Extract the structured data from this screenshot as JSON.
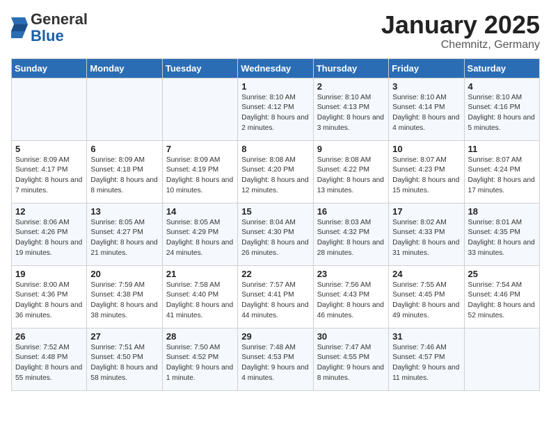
{
  "logo": {
    "general": "General",
    "blue": "Blue"
  },
  "title": "January 2025",
  "location": "Chemnitz, Germany",
  "days_of_week": [
    "Sunday",
    "Monday",
    "Tuesday",
    "Wednesday",
    "Thursday",
    "Friday",
    "Saturday"
  ],
  "weeks": [
    [
      {
        "day": "",
        "info": ""
      },
      {
        "day": "",
        "info": ""
      },
      {
        "day": "",
        "info": ""
      },
      {
        "day": "1",
        "info": "Sunrise: 8:10 AM\nSunset: 4:12 PM\nDaylight: 8 hours and 2 minutes."
      },
      {
        "day": "2",
        "info": "Sunrise: 8:10 AM\nSunset: 4:13 PM\nDaylight: 8 hours and 3 minutes."
      },
      {
        "day": "3",
        "info": "Sunrise: 8:10 AM\nSunset: 4:14 PM\nDaylight: 8 hours and 4 minutes."
      },
      {
        "day": "4",
        "info": "Sunrise: 8:10 AM\nSunset: 4:16 PM\nDaylight: 8 hours and 5 minutes."
      }
    ],
    [
      {
        "day": "5",
        "info": "Sunrise: 8:09 AM\nSunset: 4:17 PM\nDaylight: 8 hours and 7 minutes."
      },
      {
        "day": "6",
        "info": "Sunrise: 8:09 AM\nSunset: 4:18 PM\nDaylight: 8 hours and 8 minutes."
      },
      {
        "day": "7",
        "info": "Sunrise: 8:09 AM\nSunset: 4:19 PM\nDaylight: 8 hours and 10 minutes."
      },
      {
        "day": "8",
        "info": "Sunrise: 8:08 AM\nSunset: 4:20 PM\nDaylight: 8 hours and 12 minutes."
      },
      {
        "day": "9",
        "info": "Sunrise: 8:08 AM\nSunset: 4:22 PM\nDaylight: 8 hours and 13 minutes."
      },
      {
        "day": "10",
        "info": "Sunrise: 8:07 AM\nSunset: 4:23 PM\nDaylight: 8 hours and 15 minutes."
      },
      {
        "day": "11",
        "info": "Sunrise: 8:07 AM\nSunset: 4:24 PM\nDaylight: 8 hours and 17 minutes."
      }
    ],
    [
      {
        "day": "12",
        "info": "Sunrise: 8:06 AM\nSunset: 4:26 PM\nDaylight: 8 hours and 19 minutes."
      },
      {
        "day": "13",
        "info": "Sunrise: 8:05 AM\nSunset: 4:27 PM\nDaylight: 8 hours and 21 minutes."
      },
      {
        "day": "14",
        "info": "Sunrise: 8:05 AM\nSunset: 4:29 PM\nDaylight: 8 hours and 24 minutes."
      },
      {
        "day": "15",
        "info": "Sunrise: 8:04 AM\nSunset: 4:30 PM\nDaylight: 8 hours and 26 minutes."
      },
      {
        "day": "16",
        "info": "Sunrise: 8:03 AM\nSunset: 4:32 PM\nDaylight: 8 hours and 28 minutes."
      },
      {
        "day": "17",
        "info": "Sunrise: 8:02 AM\nSunset: 4:33 PM\nDaylight: 8 hours and 31 minutes."
      },
      {
        "day": "18",
        "info": "Sunrise: 8:01 AM\nSunset: 4:35 PM\nDaylight: 8 hours and 33 minutes."
      }
    ],
    [
      {
        "day": "19",
        "info": "Sunrise: 8:00 AM\nSunset: 4:36 PM\nDaylight: 8 hours and 36 minutes."
      },
      {
        "day": "20",
        "info": "Sunrise: 7:59 AM\nSunset: 4:38 PM\nDaylight: 8 hours and 38 minutes."
      },
      {
        "day": "21",
        "info": "Sunrise: 7:58 AM\nSunset: 4:40 PM\nDaylight: 8 hours and 41 minutes."
      },
      {
        "day": "22",
        "info": "Sunrise: 7:57 AM\nSunset: 4:41 PM\nDaylight: 8 hours and 44 minutes."
      },
      {
        "day": "23",
        "info": "Sunrise: 7:56 AM\nSunset: 4:43 PM\nDaylight: 8 hours and 46 minutes."
      },
      {
        "day": "24",
        "info": "Sunrise: 7:55 AM\nSunset: 4:45 PM\nDaylight: 8 hours and 49 minutes."
      },
      {
        "day": "25",
        "info": "Sunrise: 7:54 AM\nSunset: 4:46 PM\nDaylight: 8 hours and 52 minutes."
      }
    ],
    [
      {
        "day": "26",
        "info": "Sunrise: 7:52 AM\nSunset: 4:48 PM\nDaylight: 8 hours and 55 minutes."
      },
      {
        "day": "27",
        "info": "Sunrise: 7:51 AM\nSunset: 4:50 PM\nDaylight: 8 hours and 58 minutes."
      },
      {
        "day": "28",
        "info": "Sunrise: 7:50 AM\nSunset: 4:52 PM\nDaylight: 9 hours and 1 minute."
      },
      {
        "day": "29",
        "info": "Sunrise: 7:48 AM\nSunset: 4:53 PM\nDaylight: 9 hours and 4 minutes."
      },
      {
        "day": "30",
        "info": "Sunrise: 7:47 AM\nSunset: 4:55 PM\nDaylight: 9 hours and 8 minutes."
      },
      {
        "day": "31",
        "info": "Sunrise: 7:46 AM\nSunset: 4:57 PM\nDaylight: 9 hours and 11 minutes."
      },
      {
        "day": "",
        "info": ""
      }
    ]
  ]
}
